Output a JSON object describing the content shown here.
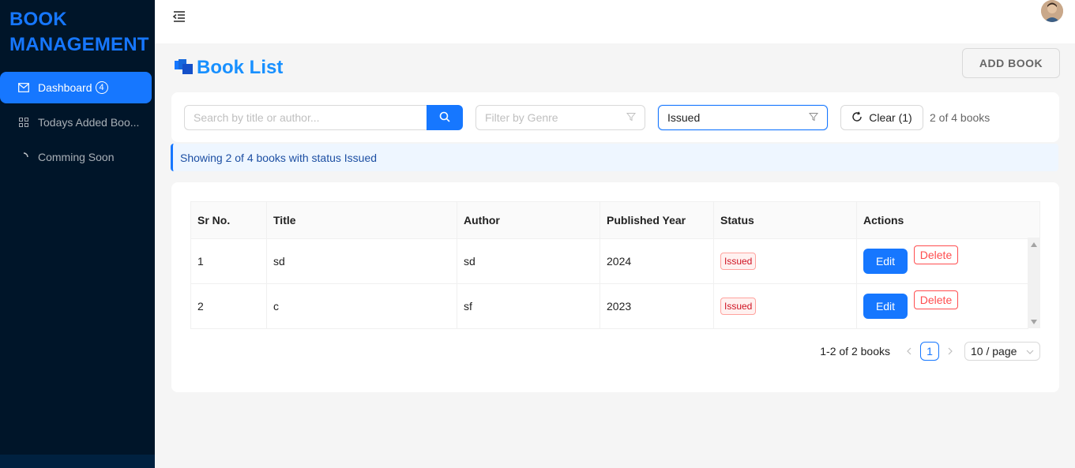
{
  "brand": {
    "line1": "BOOK",
    "line2": "MANAGEMENT"
  },
  "sidebar": {
    "items": [
      {
        "label": "Dashboard",
        "badge": "4",
        "icon": "mail-icon",
        "active": true
      },
      {
        "label": "Todays Added Boo...",
        "icon": "grid-icon",
        "active": false
      },
      {
        "label": "Comming Soon",
        "icon": "loading-icon",
        "active": false
      }
    ]
  },
  "header": {
    "toggle_icon": "menu-fold-icon",
    "avatar": "user-avatar"
  },
  "page": {
    "title": "Book List",
    "add_button": "ADD BOOK"
  },
  "filters": {
    "search_placeholder": "Search by title or author...",
    "genre_placeholder": "Filter by Genre",
    "status_value": "Issued",
    "clear_label": "Clear (1)",
    "count_text": "2 of 4 books"
  },
  "alert": {
    "text": "Showing 2 of 4 books with status Issued"
  },
  "table": {
    "columns": [
      "Sr No.",
      "Title",
      "Author",
      "Published Year",
      "Status",
      "Actions"
    ],
    "rows": [
      {
        "sr": "1",
        "title": "sd",
        "author": "sd",
        "year": "2024",
        "status": "Issued",
        "edit": "Edit",
        "delete": "Delete"
      },
      {
        "sr": "2",
        "title": "c",
        "author": "sf",
        "year": "2023",
        "status": "Issued",
        "edit": "Edit",
        "delete": "Delete"
      }
    ]
  },
  "pagination": {
    "total_text": "1-2 of 2 books",
    "current_page": "1",
    "page_size": "10 / page"
  },
  "colors": {
    "primary": "#1677ff",
    "sidebar_bg": "#001529",
    "danger": "#ff4d4f",
    "title": "#1890ff"
  }
}
